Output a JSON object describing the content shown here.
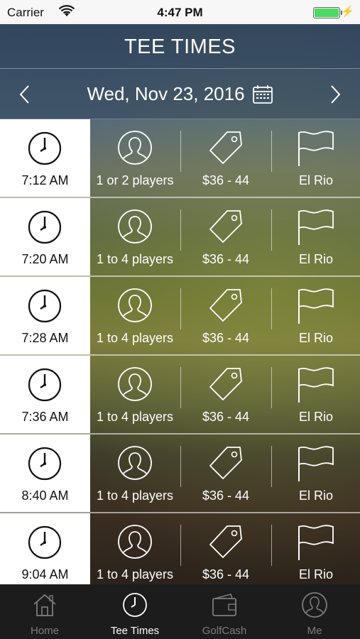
{
  "status": {
    "carrier": "Carrier",
    "time": "4:47 PM"
  },
  "header": {
    "title": "TEE TIMES"
  },
  "datebar": {
    "date": "Wed, Nov 23, 2016"
  },
  "rows": [
    {
      "time": "7:12 AM",
      "players": "1 or 2 players",
      "price": "$36 - 44",
      "course": "El Rio"
    },
    {
      "time": "7:20 AM",
      "players": "1 to 4 players",
      "price": "$36 - 44",
      "course": "El Rio"
    },
    {
      "time": "7:28 AM",
      "players": "1 to 4 players",
      "price": "$36 - 44",
      "course": "El Rio"
    },
    {
      "time": "7:36 AM",
      "players": "1 to 4 players",
      "price": "$36 - 44",
      "course": "El Rio"
    },
    {
      "time": "8:40 AM",
      "players": "1 to 4 players",
      "price": "$36 - 44",
      "course": "El Rio"
    },
    {
      "time": "9:04 AM",
      "players": "1 to 4 players",
      "price": "$36 - 44",
      "course": "El Rio"
    }
  ],
  "tabs": [
    {
      "label": "Home",
      "icon": "home-icon"
    },
    {
      "label": "Tee Times",
      "icon": "clock-icon",
      "active": true
    },
    {
      "label": "GolfCash",
      "icon": "wallet-icon"
    },
    {
      "label": "Me",
      "icon": "person-icon"
    }
  ],
  "colors": {
    "battery": "#4cd964",
    "tabbar": "#1c1c1c",
    "active_tab": "#ffffff",
    "inactive_tab": "#7d7d7d"
  }
}
